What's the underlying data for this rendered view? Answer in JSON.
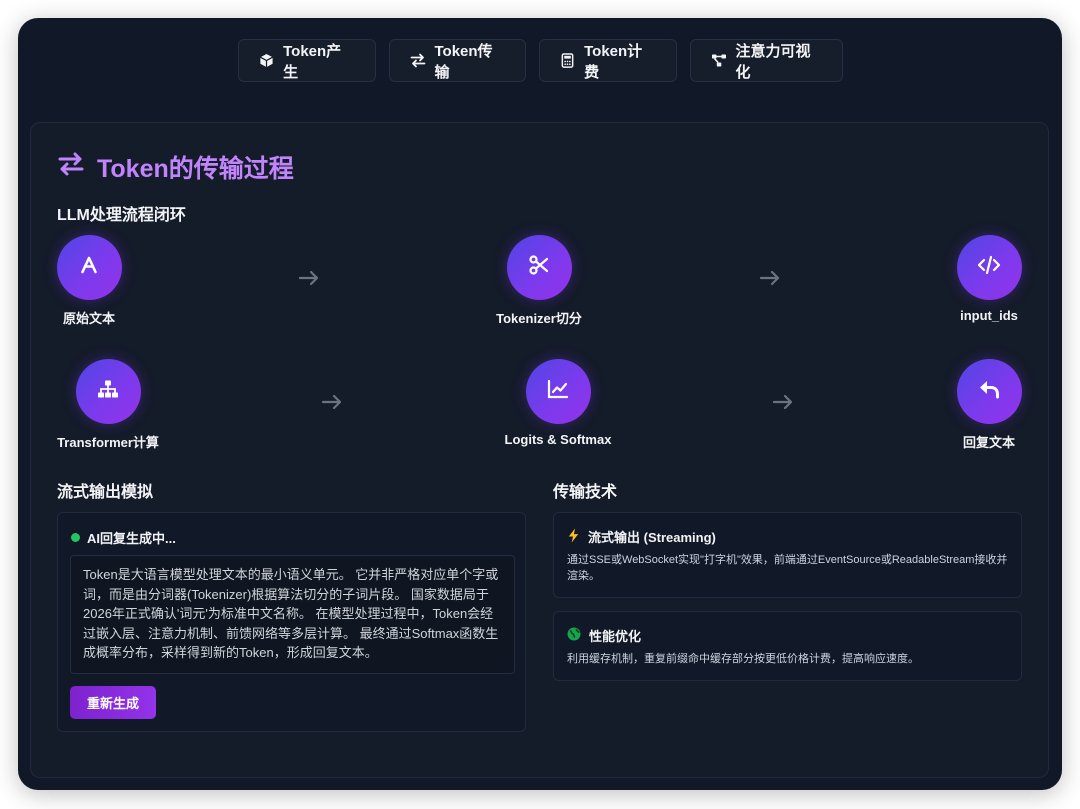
{
  "tabs": [
    {
      "label": "Token产生",
      "icon": "cube-icon"
    },
    {
      "label": "Token传输",
      "icon": "swap-arrows-icon"
    },
    {
      "label": "Token计费",
      "icon": "calculator-icon"
    },
    {
      "label": "注意力可视化",
      "icon": "nodes-icon"
    }
  ],
  "panel": {
    "title": "Token的传输过程",
    "flow_title": "LLM处理流程闭环",
    "flow_nodes": [
      {
        "label": "原始文本",
        "icon": "font-icon"
      },
      {
        "label": "Tokenizer切分",
        "icon": "scissors-icon"
      },
      {
        "label": "input_ids",
        "icon": "code-icon"
      },
      {
        "label": "Transformer计算",
        "icon": "network-icon"
      },
      {
        "label": "Logits & Softmax",
        "icon": "chart-line-icon"
      },
      {
        "label": "回复文本",
        "icon": "reply-icon"
      }
    ],
    "stream": {
      "title": "流式输出模拟",
      "status": "AI回复生成中...",
      "text": "Token是大语言模型处理文本的最小语义单元。 它并非严格对应单个字或词，而是由分词器(Tokenizer)根据算法切分的子词片段。 国家数据局于2026年正式确认'词元'为标准中文名称。 在模型处理过程中，Token会经过嵌入层、注意力机制、前馈网络等多层计算。 最终通过Softmax函数生成概率分布，采样得到新的Token，形成回复文本。",
      "button": "重新生成"
    },
    "tech": {
      "title": "传输技术",
      "items": [
        {
          "icon": "lightning-icon",
          "title": "流式输出 (Streaming)",
          "desc": "通过SSE或WebSocket实现\"打字机\"效果，前端通过EventSource或ReadableStream接收并渲染。"
        },
        {
          "icon": "globe-icon",
          "title": "性能优化",
          "desc": "利用缓存机制，重复前缀命中缓存部分按更低价格计费，提高响应速度。"
        }
      ]
    }
  },
  "colors": {
    "accent": "#c084fc",
    "background": "#111827",
    "panel": "#141b29",
    "status_dot": "#22c55e",
    "button": "#7e22ce"
  }
}
